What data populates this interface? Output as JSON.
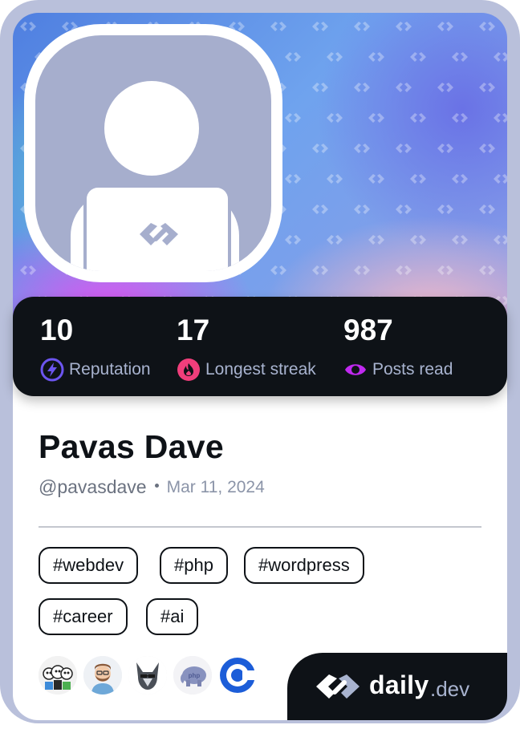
{
  "profile": {
    "name": "Pavas Dave",
    "handle": "@pavasdave",
    "joined": "Mar 11, 2024"
  },
  "stats": {
    "reputation": {
      "value": "10",
      "label": "Reputation",
      "icon": "lightning-icon",
      "color": "#6c55f0"
    },
    "streak": {
      "value": "17",
      "label": "Longest streak",
      "icon": "flame-icon",
      "color": "#f03e7b"
    },
    "posts": {
      "value": "987",
      "label": "Posts read",
      "icon": "eye-icon",
      "color": "#c029f0"
    }
  },
  "tags": [
    "#webdev",
    "#php",
    "#wordpress",
    "#career",
    "#ai"
  ],
  "stack_icons": [
    "people-avatar-icon",
    "bearded-man-avatar-icon",
    "wolf-avatar-icon",
    "php-elephant-icon",
    "c-language-icon"
  ],
  "brand": {
    "name": "daily",
    "suffix": ".dev",
    "icon": "daily-dev-logo-icon"
  },
  "colors": {
    "card_frame": "#b9c0db",
    "dark_panel": "#0e1217",
    "avatar_bg": "#a6aecd",
    "muted_label": "#a8b3cf"
  }
}
